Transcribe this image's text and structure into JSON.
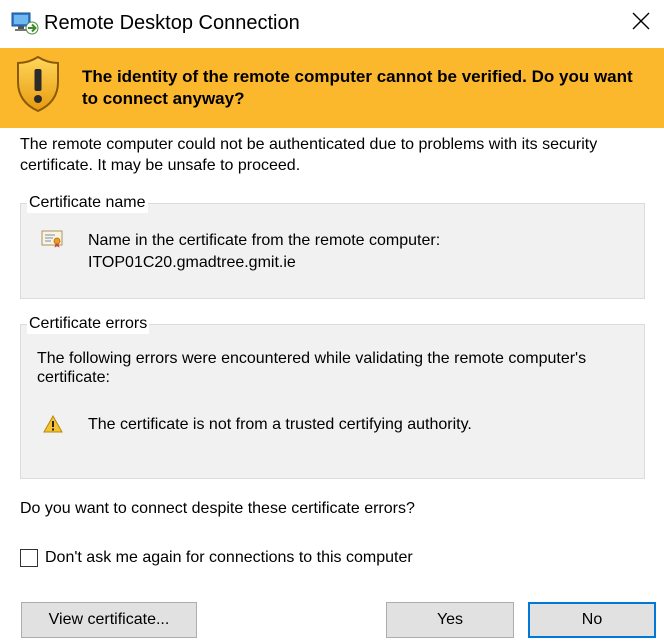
{
  "window": {
    "title": "Remote Desktop Connection",
    "app_icon": "remote-desktop-icon",
    "close_icon": "close-icon"
  },
  "banner": {
    "icon": "shield-warning-icon",
    "background": "#fcb82c",
    "text": "The identity of the remote computer cannot be verified. Do you want to connect anyway?"
  },
  "intro": "The remote computer could not be authenticated due to problems with its security certificate. It may be unsafe to proceed.",
  "certificate_name": {
    "label": "Certificate name",
    "icon": "certificate-icon",
    "line1": "Name in the certificate from the remote computer:",
    "line2": "ITOP01C20.gmadtree.gmit.ie"
  },
  "certificate_errors": {
    "label": "Certificate errors",
    "description": "The following errors were encountered while validating the remote computer's certificate:",
    "icon": "warning-icon",
    "items": [
      "The certificate is not from a trusted certifying authority."
    ]
  },
  "question": "Do you want to connect despite these certificate errors?",
  "checkbox": {
    "label": "Don't ask me again for connections to this computer",
    "checked": false
  },
  "buttons": {
    "view_certificate": "View certificate...",
    "yes": "Yes",
    "no": "No"
  },
  "colors": {
    "accent": "#0078d7",
    "button_face": "#e1e1e1",
    "group_background": "#f1f1f1"
  }
}
